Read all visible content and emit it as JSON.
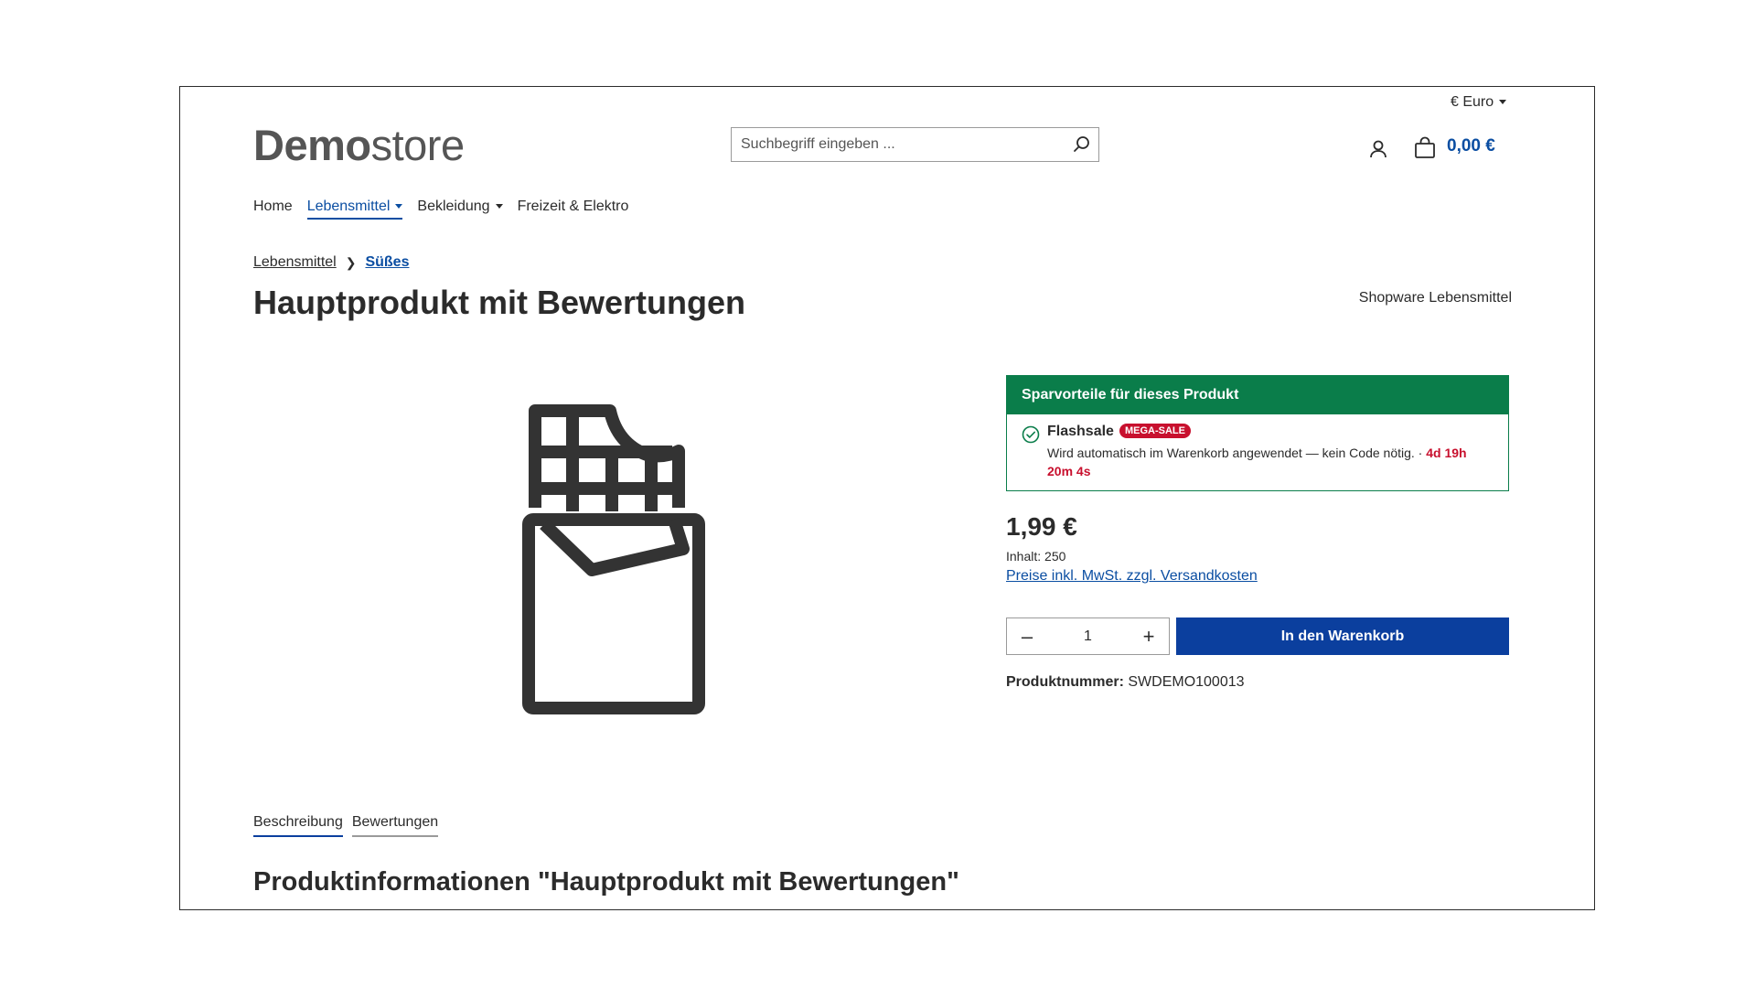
{
  "header": {
    "currency": "€ Euro",
    "logo_bold": "Demo",
    "logo_light": "store",
    "search_placeholder": "Suchbegriff eingeben ...",
    "cart_total": "0,00 €"
  },
  "nav": {
    "items": [
      {
        "label": "Home",
        "active": false,
        "dropdown": false
      },
      {
        "label": "Lebensmittel",
        "active": true,
        "dropdown": true
      },
      {
        "label": "Bekleidung",
        "active": false,
        "dropdown": true
      },
      {
        "label": "Freizeit & Elektro",
        "active": false,
        "dropdown": false
      }
    ]
  },
  "breadcrumb": {
    "items": [
      "Lebensmittel",
      "Süßes"
    ]
  },
  "product": {
    "title": "Hauptprodukt mit Bewertungen",
    "manufacturer": "Shopware Lebensmittel",
    "image_icon": "chocolate-bar-icon",
    "price": "1,99 €",
    "content": "Inhalt: 250",
    "tax_note": "Preise inkl. MwSt. zzgl. Versandkosten",
    "quantity": "1",
    "buy_label": "In den Warenkorb",
    "sku_label": "Produktnummer:",
    "sku_value": "SWDEMO100013"
  },
  "deal": {
    "header": "Sparvorteile für dieses Produkt",
    "title": "Flashsale",
    "badge": "MEGA-SALE",
    "text": "Wird automatisch im Warenkorb angewendet — kein Code nötig. · ",
    "countdown": "4d 19h 20m 4s"
  },
  "tabs": [
    {
      "label": "Beschreibung",
      "active": true
    },
    {
      "label": "Bewertungen",
      "active": false
    }
  ],
  "section_title": "Produktinformationen \"Hauptprodukt mit Bewertungen\"",
  "colors": {
    "accent": "#0b4ea2",
    "button": "#0b3f9e",
    "deal_green": "#0a7d4a",
    "sale_red": "#c8102e"
  }
}
